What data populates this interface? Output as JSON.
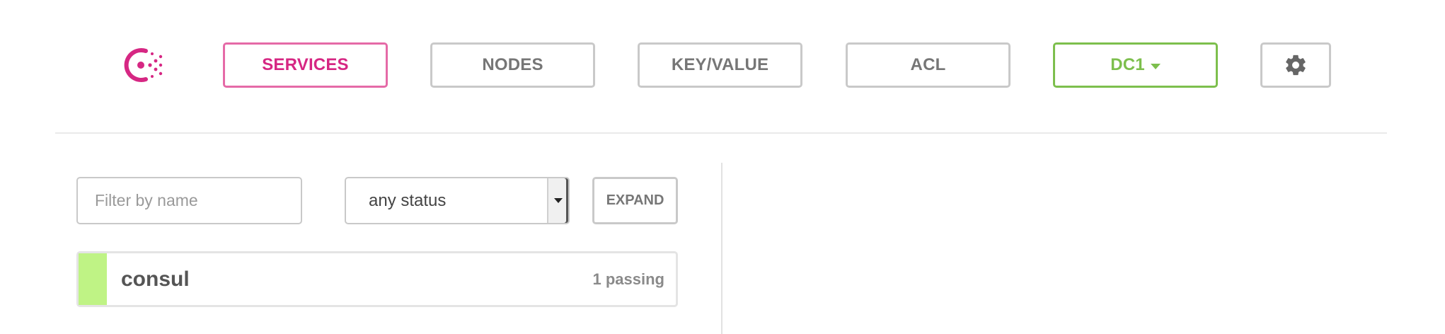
{
  "nav": {
    "services_label": "SERVICES",
    "nodes_label": "NODES",
    "keyvalue_label": "KEY/VALUE",
    "acl_label": "ACL",
    "datacenter_label": "DC1"
  },
  "filters": {
    "name_placeholder": "Filter by name",
    "status_value": "any status",
    "expand_label": "EXPAND"
  },
  "services": [
    {
      "name": "consul",
      "status_text": "1 passing"
    }
  ],
  "colors": {
    "brand": "#d62783",
    "active_border": "#e56aa7",
    "datacenter": "#7dbf4d",
    "passing": "#bff385",
    "neutral_border": "#c9c9c9"
  }
}
